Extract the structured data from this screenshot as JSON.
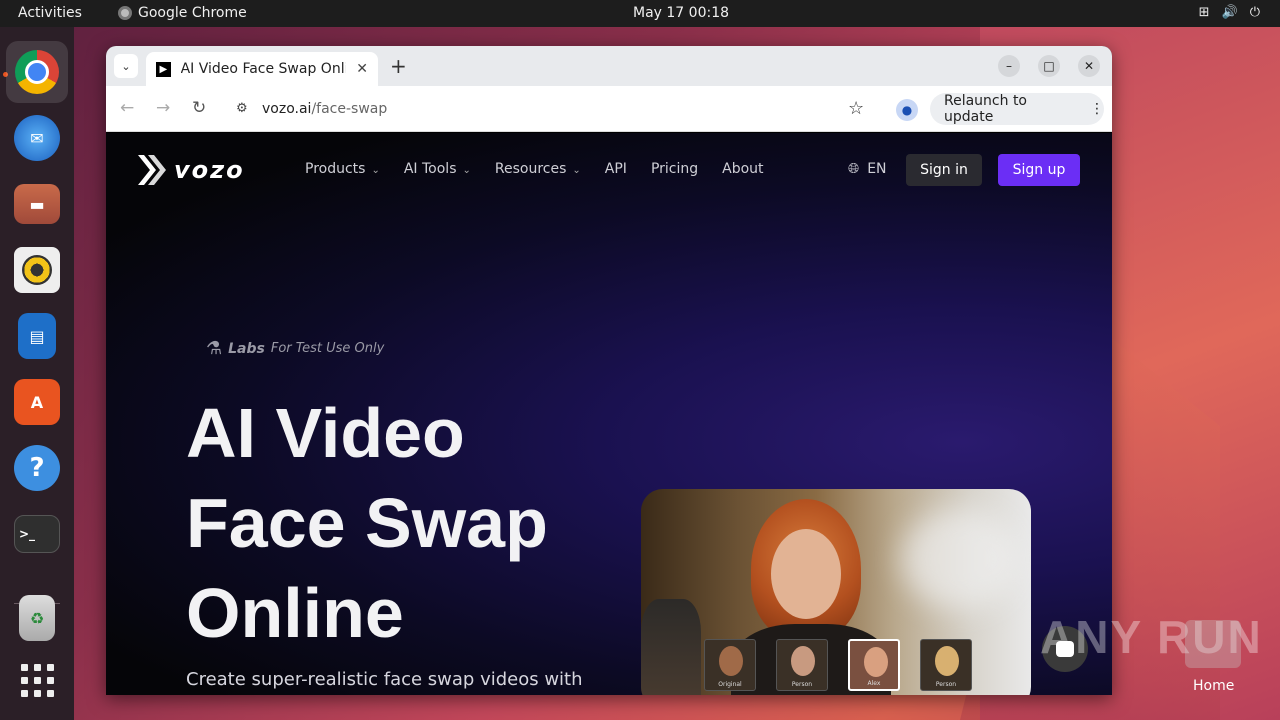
{
  "topbar": {
    "activities": "Activities",
    "app_name": "Google Chrome",
    "clock": "May 17  00:18"
  },
  "dock": {
    "items": [
      "chrome-icon",
      "thunderbird-icon",
      "files-icon",
      "rhythmbox-icon",
      "writer-icon",
      "app-center-icon",
      "help-icon",
      "terminal-icon",
      "trash-icon",
      "show-apps-icon"
    ]
  },
  "browser": {
    "tab_title": "AI Video Face Swap Online",
    "url_host": "vozo.ai",
    "url_path": "/face-swap",
    "relaunch_label": "Relaunch to update"
  },
  "site": {
    "logo_text": "vozo",
    "nav": [
      {
        "label": "Products",
        "dropdown": true
      },
      {
        "label": "AI Tools",
        "dropdown": true
      },
      {
        "label": "Resources",
        "dropdown": true
      },
      {
        "label": "API",
        "dropdown": false
      },
      {
        "label": "Pricing",
        "dropdown": false
      },
      {
        "label": "About",
        "dropdown": false
      }
    ],
    "language": "EN",
    "signin": "Sign in",
    "signup": "Sign up",
    "signup_color": "#6b2ef5",
    "labs_label": "Labs",
    "labs_note": "For Test Use Only",
    "hero_title_lines": [
      "AI Video",
      "Face Swap",
      "Online"
    ],
    "hero_subtitle": "Create super-realistic face swap videos with",
    "thumbnails": [
      {
        "caption": "Original",
        "selected": false
      },
      {
        "caption": "Person",
        "selected": false
      },
      {
        "caption": "Alex",
        "selected": true
      },
      {
        "caption": "Person",
        "selected": false
      }
    ]
  },
  "desktop": {
    "home_label": "Home",
    "watermark": "ANY RUN"
  }
}
